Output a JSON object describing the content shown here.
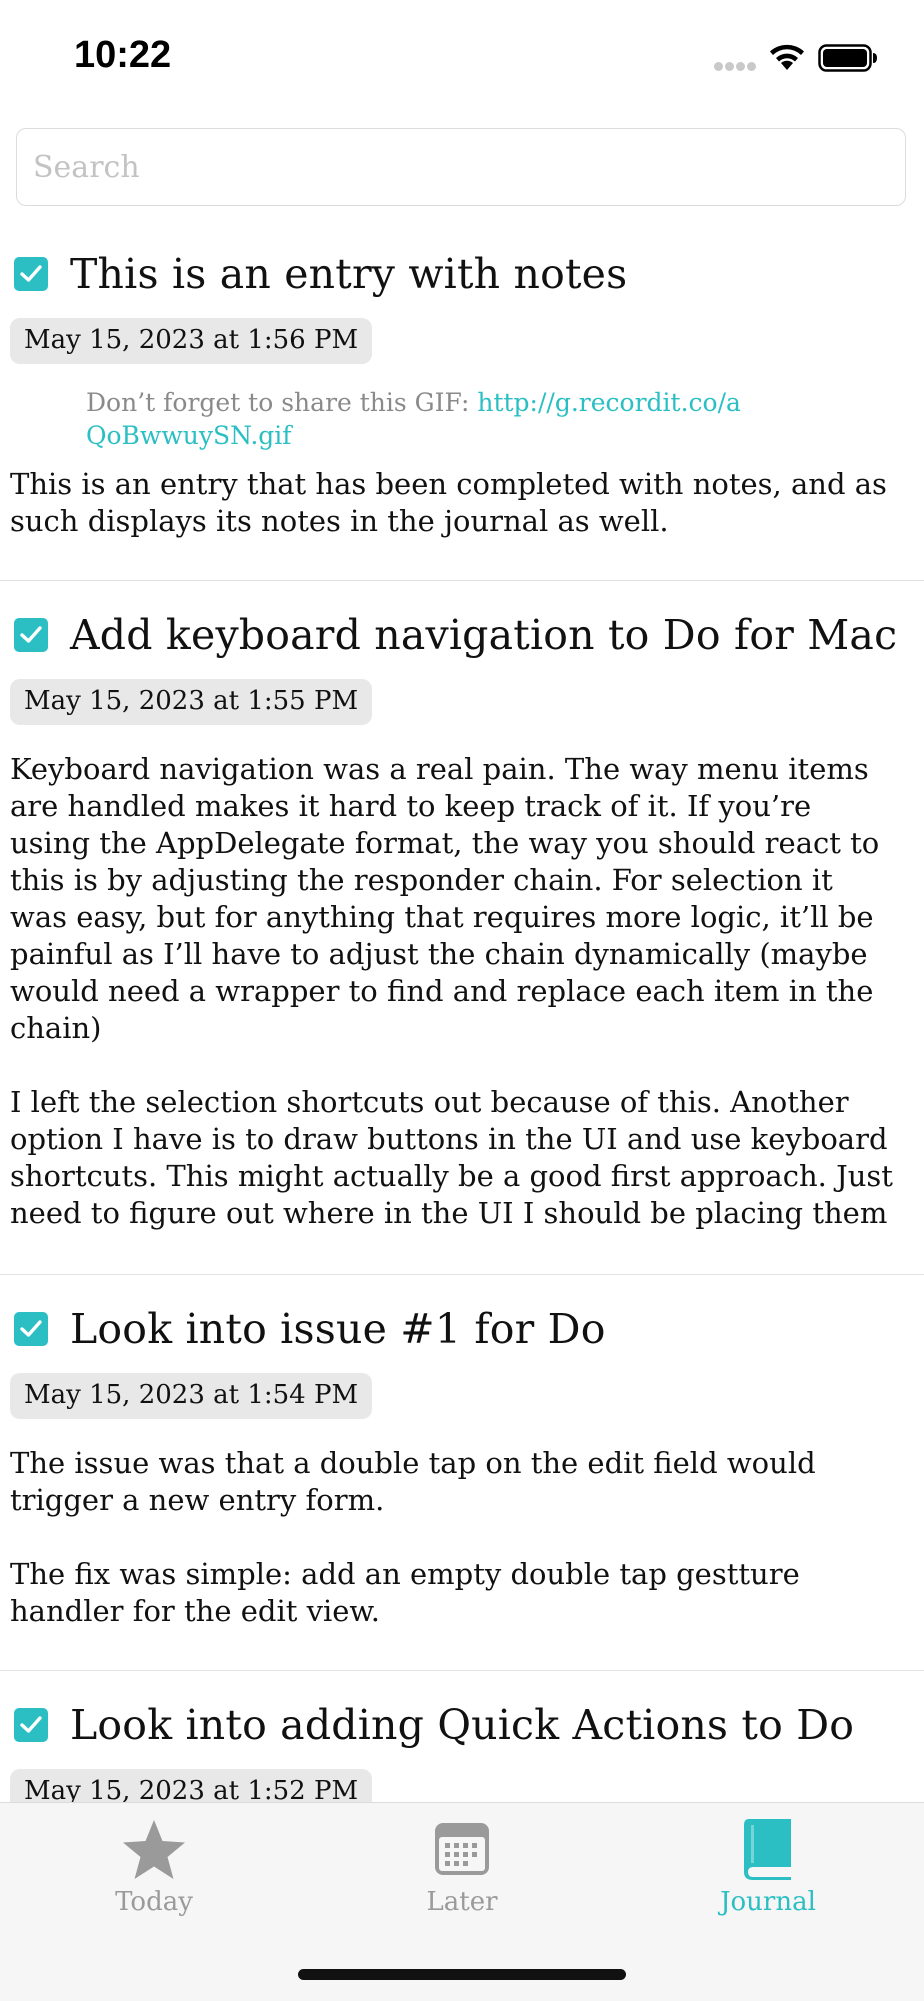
{
  "status_bar": {
    "time": "10:22"
  },
  "search": {
    "placeholder": "Search",
    "value": ""
  },
  "entries": [
    {
      "title": "This is an entry with notes",
      "date": "May 15, 2023 at 1:56 PM",
      "note_prefix": "Don’t forget to share this GIF: ",
      "note_link": "http://g.recordit.co/aQoBwwuySN.gif",
      "paragraphs": [
        "This is an entry that has been completed with notes, and as such displays its notes in the journal as well."
      ]
    },
    {
      "title": "Add keyboard navigation to Do for Mac",
      "date": "May 15, 2023 at 1:55 PM",
      "paragraphs": [
        "Keyboard navigation was a real pain. The way menu items are handled makes it hard to keep track of it. If you’re using the AppDelegate format, the way you should react to this is by adjusting the responder chain. For selection it was easy, but for anything that requires more logic, it’ll be painful as I’ll have to adjust the chain dynamically (maybe would need a wrapper to find and replace each item in the chain)",
        "I left the selection shortcuts out because of this. Another option I have is to draw buttons in the UI and use keyboard shortcuts. This might actually be a good first approach. Just need to figure out where in the UI I should be placing them"
      ]
    },
    {
      "title": "Look into issue #1 for Do",
      "date": "May 15, 2023 at 1:54 PM",
      "paragraphs": [
        "The issue was that a double tap on the edit field would trigger a new entry form.",
        "The fix was simple: add an empty double tap gestture handler for the edit view."
      ]
    },
    {
      "title": "Look into adding Quick Actions to Do",
      "date": "May 15, 2023 at 1:52 PM"
    }
  ],
  "tabs": [
    {
      "label": "Today",
      "icon": "star-icon",
      "active": false
    },
    {
      "label": "Later",
      "icon": "calendar-icon",
      "active": false
    },
    {
      "label": "Journal",
      "icon": "book-icon",
      "active": true
    }
  ],
  "colors": {
    "accent": "#2bbfc4",
    "inactive_tab": "#9a9a9a",
    "pill": "#e8e8e8"
  }
}
